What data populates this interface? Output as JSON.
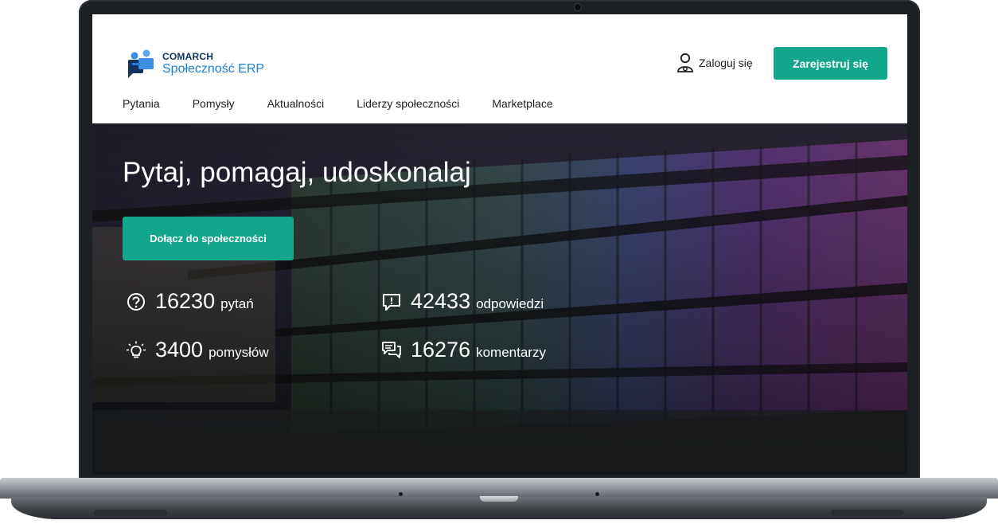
{
  "brand": {
    "company": "COMARCH",
    "product": "Społeczność ERP"
  },
  "header": {
    "login_label": "Zaloguj się",
    "register_label": "Zarejestruj się"
  },
  "nav": {
    "items": [
      {
        "label": "Pytania"
      },
      {
        "label": "Pomysły"
      },
      {
        "label": "Aktualności"
      },
      {
        "label": "Liderzy społeczności"
      },
      {
        "label": "Marketplace"
      }
    ]
  },
  "hero": {
    "title": "Pytaj, pomagaj, udoskonalaj",
    "cta_label": "Dołącz do społeczności"
  },
  "stats": [
    {
      "icon": "question-circle-icon",
      "value": "16230",
      "label": "pytań"
    },
    {
      "icon": "answer-bubble-icon",
      "value": "42433",
      "label": "odpowiedzi"
    },
    {
      "icon": "lightbulb-icon",
      "value": "3400",
      "label": "pomysłów"
    },
    {
      "icon": "comments-icon",
      "value": "16276",
      "label": "komentarzy"
    }
  ],
  "colors": {
    "accent": "#12a68a",
    "brand_dark": "#12335e",
    "brand_blue": "#1a7fd8"
  }
}
